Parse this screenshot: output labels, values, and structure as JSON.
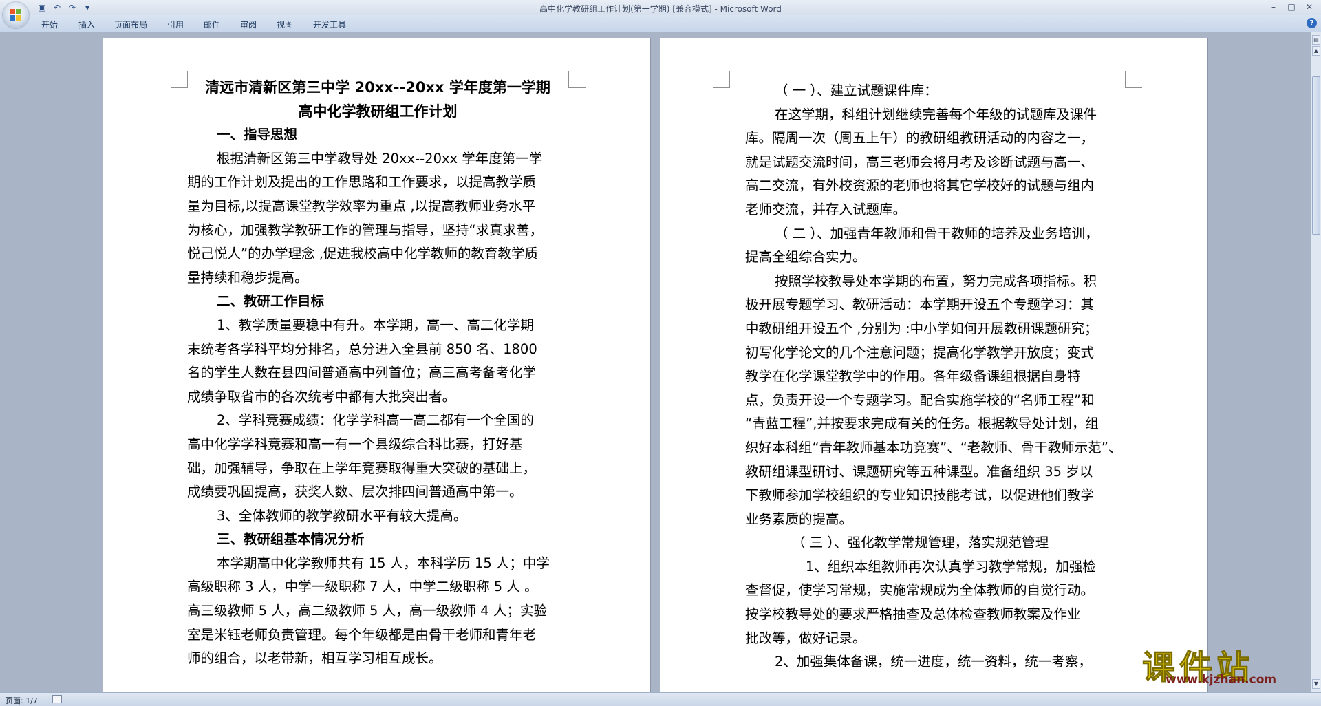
{
  "window": {
    "title": "高中化学教研组工作计划(第一学期) [兼容模式] - Microsoft Word",
    "icons": [
      "save-icon",
      "undo-icon",
      "redo-icon",
      "customize-qat-icon",
      "minimize-icon",
      "maximize-icon",
      "close-icon",
      "help-icon"
    ]
  },
  "ribbon": {
    "tabs": [
      "开始",
      "插入",
      "页面布局",
      "引用",
      "邮件",
      "审阅",
      "视图",
      "开发工具"
    ]
  },
  "status": {
    "page": "页面: 1/7"
  },
  "watermark": {
    "main": "课件站",
    "sub": "www.kjzhan.com"
  },
  "document": {
    "left_page": [
      "清远市清新区第三中学 20xx--20xx 学年度第一学期",
      "高中化学教研组工作计划",
      "一、指导思想",
      "根据清新区第三中学教导处  20xx--20xx  学年度第一学",
      "期的工作计划及提出的工作思路和工作要求，以提高教学质",
      "量为目标,以提高课堂教学效率为重点 ,以提高教师业务水平",
      "为核心，加强教学教研工作的管理与指导，坚持“求真求善，",
      "悦己悦人”的办学理念 ,促进我校高中化学教师的教育教学质",
      "量持续和稳步提高。",
      "二、教研工作目标",
      "1、教学质量要稳中有升。本学期，高一、高二化学期",
      "末统考各学科平均分排名，总分进入全县前  850  名、1800",
      "名的学生人数在县四间普通高中列首位；高三高考备考化学",
      "成绩争取省市的各次统考中都有大批突出者。",
      "2、学科竞赛成绩：化学学科高一高二都有一个全国的",
      "高中化学学科竞赛和高一有一个县级综合科比赛，打好基",
      "础，加强辅导，争取在上学年竞赛取得重大突破的基础上，",
      "成绩要巩固提高，获奖人数、层次排四间普通高中第一。",
      "3、全体教师的教学教研水平有较大提高。",
      "三、教研组基本情况分析",
      "本学期高中化学教师共有 15 人，本科学历 15 人；中学",
      "高级职称 3 人，中学一级职称 7 人，中学二级职称 5 人 。",
      "高三级教师 5 人，高二级教师 5 人，高一级教师 4 人；实验",
      "室是米钰老师负责管理。每个年级都是由骨干老师和青年老",
      "师的组合，以老带新，相互学习相互成长。"
    ],
    "right_page": [
      "（ 一 ）、建立试题课件库：",
      "在这学期，科组计划继续完善每个年级的试题库及课件",
      "库。隔周一次（周五上午）的教研组教研活动的内容之一，",
      "就是试题交流时间，高三老师会将月考及诊断试题与高一、",
      "高二交流，有外校资源的老师也将其它学校好的试题与组内",
      "老师交流，并存入试题库。",
      "（ 二 ）、加强青年教师和骨干教师的培养及业务培训，",
      "提高全组综合实力。",
      "按照学校教导处本学期的布置，努力完成各项指标。积",
      "极开展专题学习、教研活动：本学期开设五个专题学习：其",
      "中教研组开设五个 ,分别为 :中小学如何开展教研课题研究；",
      "初写化学论文的几个注意问题；提高化学教学开放度；变式",
      "教学在化学课堂教学中的作用。各年级备课组根据自身特",
      "点，负责开设一个专题学习。配合实施学校的“名师工程”和",
      "“青蓝工程”,并按要求完成有关的任务。根据教导处计划，组",
      "织好本科组“青年教师基本功竞赛”、“老教师、骨干教师示范”、",
      "教研组课型研讨、课题研究等五种课型。准备组织 35 岁以",
      "下教师参加学校组织的专业知识技能考试，以促进他们教学",
      "业务素质的提高。",
      "（ 三 ）、强化教学常规管理，落实规范管理",
      "1、组织本组教师再次认真学习教学常规，加强检",
      "查督促，使学习常规，实施常规成为全体教师的自觉行动。",
      "按学校教导处的要求严格抽查及总体检查教师教案及作业",
      "批改等，做好记录。",
      "2、加强集体备课，统一进度，统一资料，统一考察，"
    ]
  }
}
